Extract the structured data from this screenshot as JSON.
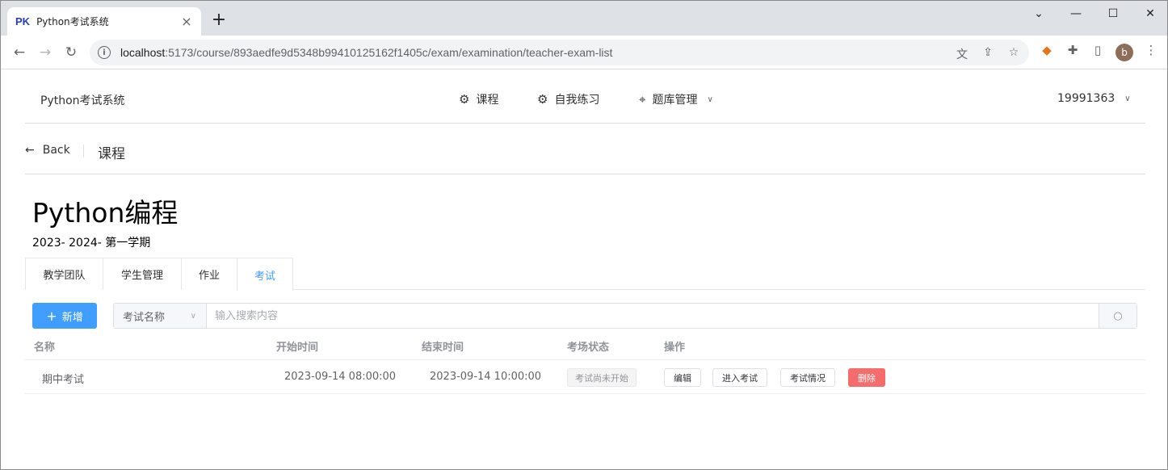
{
  "browser": {
    "tab_favicon": "PK",
    "tab_title": "Python考试系统",
    "url_host": "localhost",
    "url_path": ":5173/course/893aedfe9d5348b99410125162f1405c/exam/examination/teacher-exam-list",
    "avatar_letter": "b"
  },
  "header": {
    "brand": "Python考试系统",
    "menu": [
      {
        "label": "课程",
        "icon": "gear-icon"
      },
      {
        "label": "自我练习",
        "icon": "gear-icon"
      },
      {
        "label": "题库管理",
        "icon": "location-pin-icon"
      }
    ],
    "user": "19991363"
  },
  "page_header": {
    "back_label": "Back",
    "title": "课程"
  },
  "course": {
    "title": "Python编程",
    "term": "2023- 2024- 第一学期"
  },
  "tabs": [
    {
      "label": "教学团队",
      "active": false
    },
    {
      "label": "学生管理",
      "active": false
    },
    {
      "label": "作业",
      "active": false
    },
    {
      "label": "考试",
      "active": true
    }
  ],
  "toolbar": {
    "add_label": "新增",
    "search_field": "考试名称",
    "search_placeholder": "输入搜索内容"
  },
  "table": {
    "columns": [
      "名称",
      "开始时间",
      "结束时间",
      "考场状态",
      "操作"
    ],
    "rows": [
      {
        "name": "期中考试",
        "start": "2023-09-14 08:00:00",
        "end": "2023-09-14 10:00:00",
        "status": "考试尚未开始",
        "actions": [
          "编辑",
          "进入考试",
          "考试情况",
          "删除"
        ]
      }
    ]
  },
  "colors": {
    "primary": "#409eff",
    "danger": "#f56c6c"
  }
}
